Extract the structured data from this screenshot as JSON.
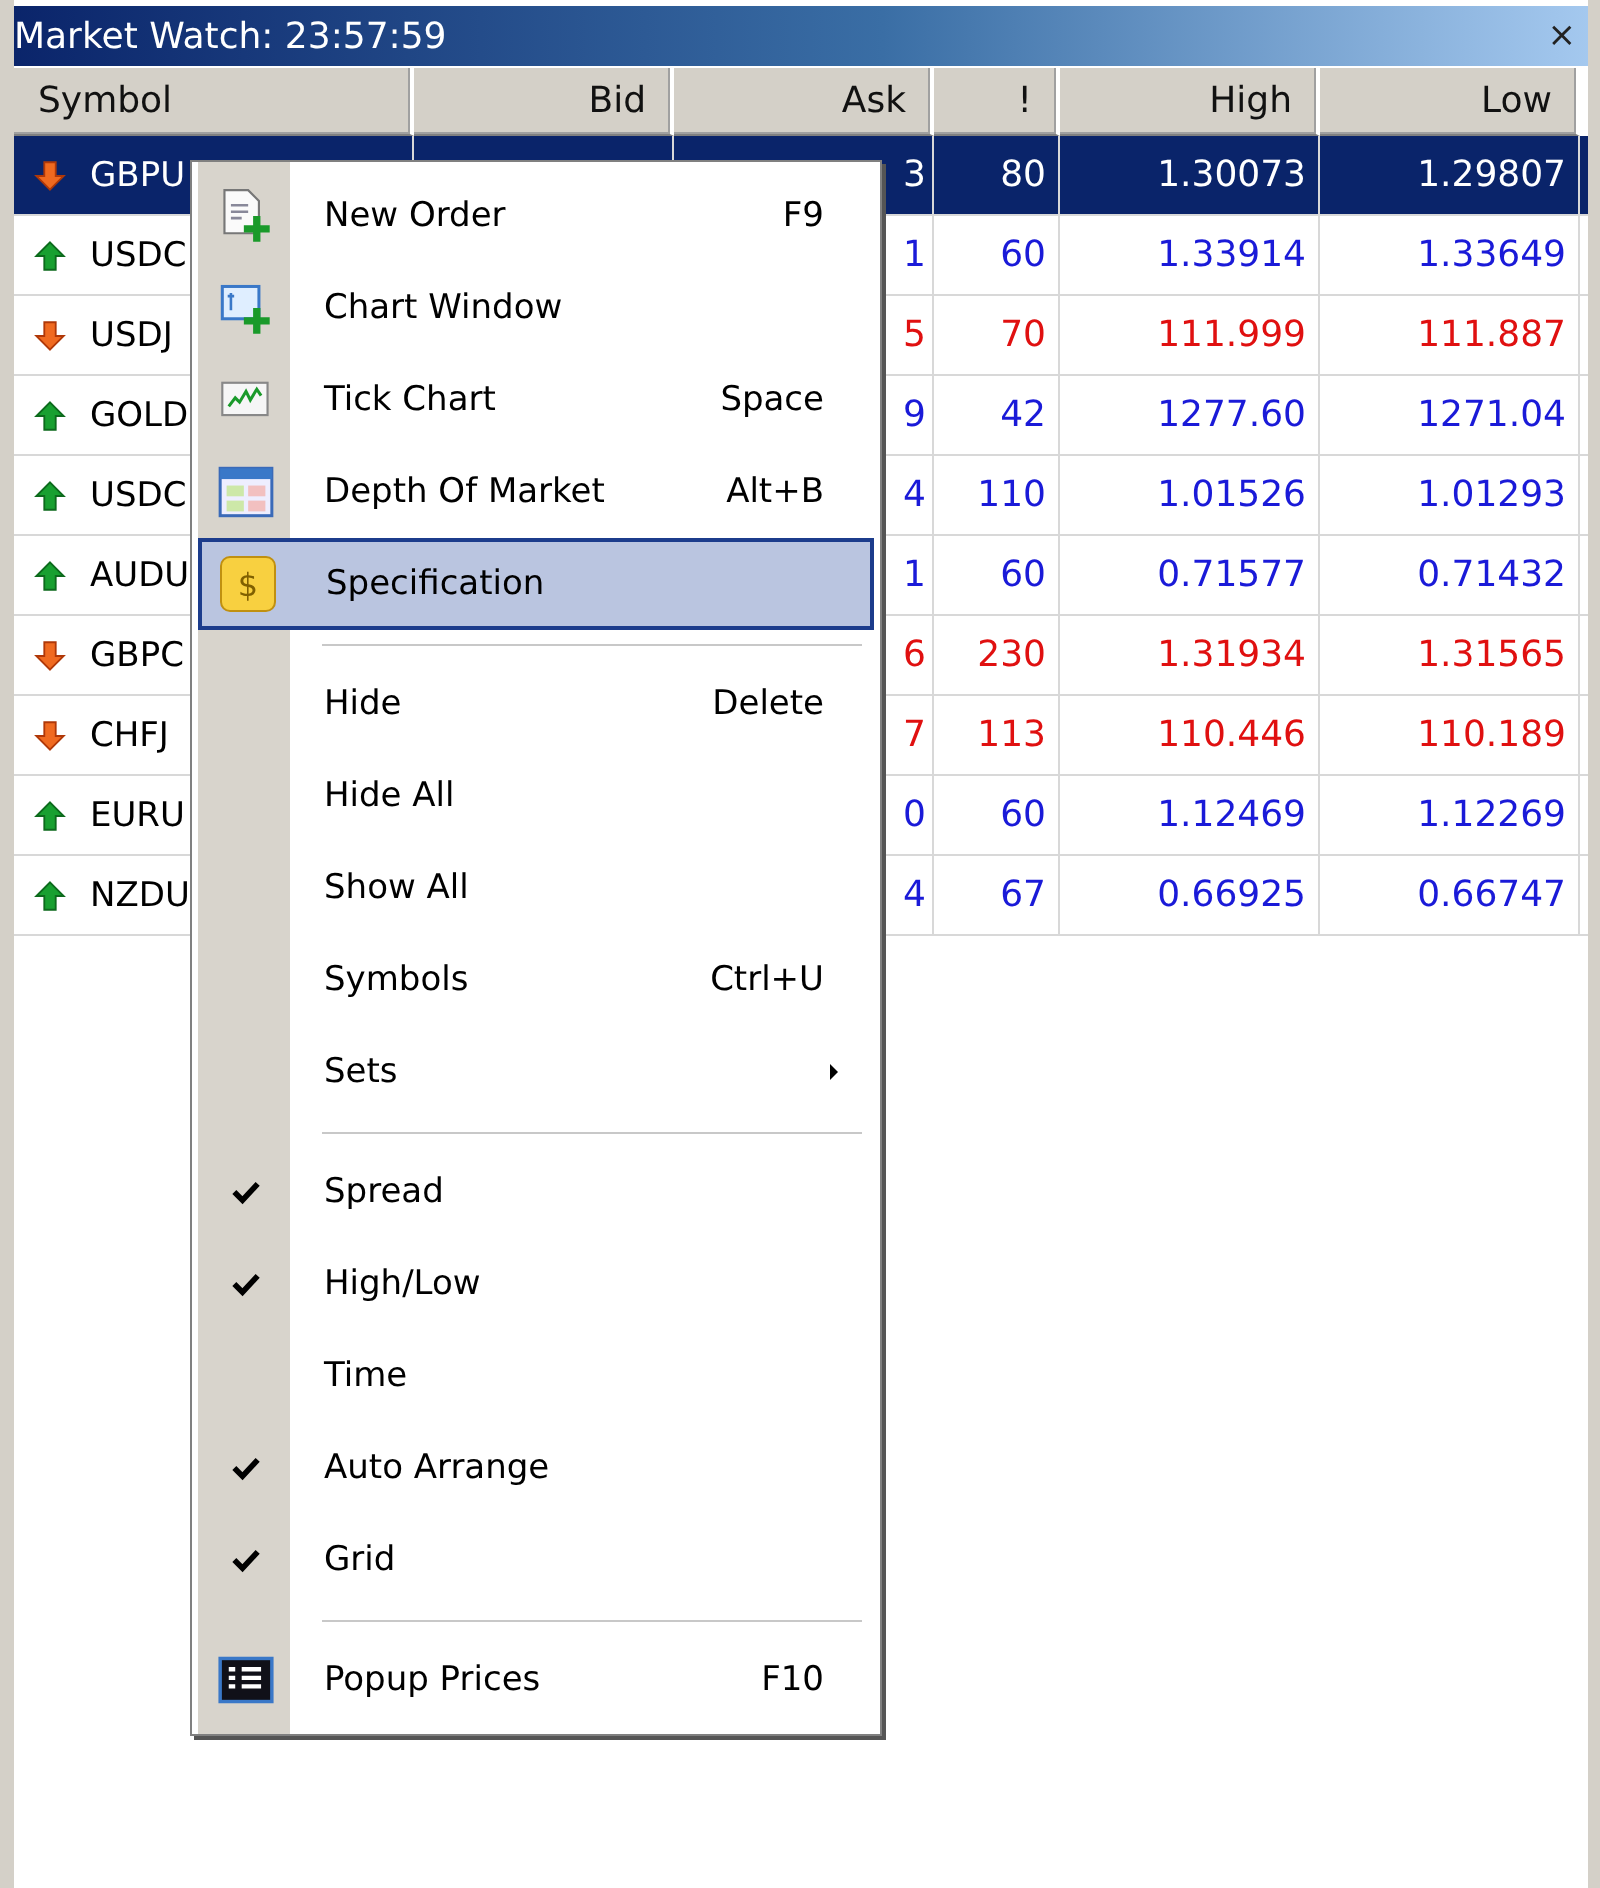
{
  "window": {
    "title": "Market Watch: 23:57:59",
    "close": "×"
  },
  "table": {
    "columns": [
      "Symbol",
      "Bid",
      "Ask",
      "!",
      "High",
      "Low"
    ],
    "rows": [
      {
        "symbol": "GBPU",
        "rising": false,
        "ask": "3",
        "spread": "80",
        "high": "1.30073",
        "low": "1.29807",
        "selected": true
      },
      {
        "symbol": "USDC",
        "rising": true,
        "ask": "1",
        "spread": "60",
        "high": "1.33914",
        "low": "1.33649",
        "selected": false
      },
      {
        "symbol": "USDJ",
        "rising": false,
        "ask": "5",
        "spread": "70",
        "high": "111.999",
        "low": "111.887",
        "selected": false
      },
      {
        "symbol": "GOLD",
        "rising": true,
        "ask": "9",
        "spread": "42",
        "high": "1277.60",
        "low": "1271.04",
        "selected": false
      },
      {
        "symbol": "USDC",
        "rising": true,
        "ask": "4",
        "spread": "110",
        "high": "1.01526",
        "low": "1.01293",
        "selected": false
      },
      {
        "symbol": "AUDU",
        "rising": true,
        "ask": "1",
        "spread": "60",
        "high": "0.71577",
        "low": "0.71432",
        "selected": false
      },
      {
        "symbol": "GBPC",
        "rising": false,
        "ask": "6",
        "spread": "230",
        "high": "1.31934",
        "low": "1.31565",
        "selected": false
      },
      {
        "symbol": "CHFJ",
        "rising": false,
        "ask": "7",
        "spread": "113",
        "high": "110.446",
        "low": "110.189",
        "selected": false
      },
      {
        "symbol": "EURU",
        "rising": true,
        "ask": "0",
        "spread": "60",
        "high": "1.12469",
        "low": "1.12269",
        "selected": false
      },
      {
        "symbol": "NZDU",
        "rising": true,
        "ask": "4",
        "spread": "67",
        "high": "0.66925",
        "low": "0.66747",
        "selected": false
      }
    ]
  },
  "context_menu": {
    "items": [
      {
        "kind": "item",
        "label": "New Order",
        "shortcut": "F9",
        "checked": false,
        "selected": false
      },
      {
        "kind": "item",
        "label": "Chart Window",
        "checked": false,
        "selected": false
      },
      {
        "kind": "item",
        "label": "Tick Chart",
        "shortcut": "Space",
        "checked": false,
        "selected": false
      },
      {
        "kind": "item",
        "label": "Depth Of Market",
        "shortcut": "Alt+B",
        "checked": false,
        "selected": false
      },
      {
        "kind": "item",
        "label": "Specification",
        "icon_text": "$",
        "checked": false,
        "selected": true
      },
      {
        "kind": "separator"
      },
      {
        "kind": "item",
        "label": "Hide",
        "shortcut": "Delete",
        "checked": false,
        "selected": false
      },
      {
        "kind": "item",
        "label": "Hide All",
        "checked": false,
        "selected": false
      },
      {
        "kind": "item",
        "label": "Show All",
        "checked": false,
        "selected": false
      },
      {
        "kind": "item",
        "label": "Symbols",
        "shortcut": "Ctrl+U",
        "checked": false,
        "selected": false
      },
      {
        "kind": "item",
        "label": "Sets",
        "submenu": true,
        "checked": false,
        "selected": false
      },
      {
        "kind": "separator"
      },
      {
        "kind": "item",
        "label": "Spread",
        "checked": true,
        "selected": false
      },
      {
        "kind": "item",
        "label": "High/Low",
        "checked": true,
        "selected": false
      },
      {
        "kind": "item",
        "label": "Time",
        "checked": false,
        "selected": false
      },
      {
        "kind": "item",
        "label": "Auto Arrange",
        "checked": true,
        "selected": false
      },
      {
        "kind": "item",
        "label": "Grid",
        "checked": true,
        "selected": false
      },
      {
        "kind": "separator"
      },
      {
        "kind": "item",
        "label": "Popup Prices",
        "shortcut": "F10",
        "checked": false,
        "selected": false
      }
    ]
  }
}
